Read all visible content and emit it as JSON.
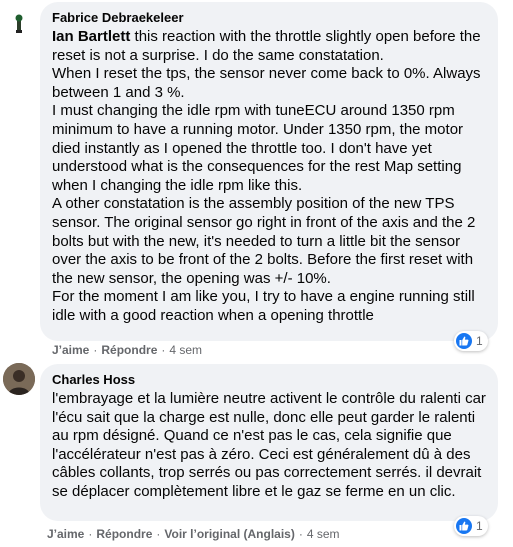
{
  "comments": [
    {
      "author": "Fabrice Debraekeleer",
      "mention": "Ian Bartlett",
      "first_line_rest": " this reaction with the throttle slightly open before the reset is not a surprise. I do the same constatation.",
      "paragraphs": [
        "When I reset the tps, the sensor never come back to 0%. Always between 1 and 3 %.",
        "I must changing the idle rpm with tuneECU around 1350 rpm minimum to have a running motor. Under 1350 rpm, the motor died instantly as I opened the throttle too. I don't have yet understood what is the consequences for the rest Map setting when I changing the idle rpm like this.",
        "A other constatation is the assembly position of the new TPS sensor. The original sensor go right in front of the axis and the 2 bolts but with the new, it's needed to turn a little bit the sensor over the axis to be front of the 2 bolts. Before the first reset with the new sensor, the opening was +/- 10%.",
        "For the moment I am like you, I try to have a engine running still idle with a good reaction when a opening throttle"
      ],
      "like_label": "J’aime",
      "reply_label": "Répondre",
      "time": "4 sem",
      "reaction_count": "1",
      "reaction_icon": "like-icon"
    },
    {
      "author": "Charles Hoss",
      "body": "l'embrayage et la lumière neutre activent le contrôle du ralenti car l'écu sait que la charge est nulle, donc elle peut garder le ralenti au rpm désigné. Quand ce n'est pas le cas, cela signifie que l'accélérateur n'est pas à zéro. Ceci est généralement dû à des câbles collants, trop serrés ou pas correctement serrés. il devrait se déplacer complètement libre et le gaz se ferme en un clic.",
      "like_label": "J’aime",
      "reply_label": "Répondre",
      "see_original_label": "Voir l’original (Anglais)",
      "time": "4 sem",
      "reaction_count": "1",
      "reaction_icon": "like-icon"
    }
  ],
  "colors": {
    "bubble": "#f0f2f5",
    "text": "#050505",
    "secondary": "#65676b",
    "like_blue": "#1877f2"
  }
}
